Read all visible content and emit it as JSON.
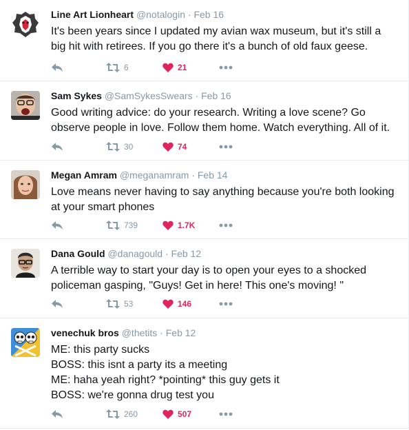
{
  "colors": {
    "like": "#e0245e",
    "meta": "#8899a6",
    "text": "#14171a",
    "divider": "#e6ecf0"
  },
  "icons": {
    "reply": "reply-icon",
    "retweet": "retweet-icon",
    "like": "heart-icon",
    "more": "more-dots-icon"
  },
  "tweets": [
    {
      "name": "Line Art Lionheart",
      "handle": "@notalogin",
      "dot": "·",
      "time": "Feb 16",
      "lines": [
        "It's been years since I updated my avian wax museum, but it's still a",
        "big hit with retirees. If you go there it's a bunch of old faux geese."
      ],
      "retweets": "6",
      "likes": "21"
    },
    {
      "name": "Sam Sykes",
      "handle": "@SamSykesSwears",
      "dot": "·",
      "time": "Feb 16",
      "lines": [
        "Good writing advice: do your research. Writing a love scene? Go",
        "observe people in love. Follow them home. Watch everything. All of it."
      ],
      "retweets": "30",
      "likes": "74"
    },
    {
      "name": "Megan Amram",
      "handle": "@meganamram",
      "dot": "·",
      "time": "Feb 14",
      "lines": [
        "Love means never having to say anything because you're both looking",
        "at your smart phones"
      ],
      "retweets": "739",
      "likes": "1.7K"
    },
    {
      "name": "Dana Gould",
      "handle": "@danagould",
      "dot": "·",
      "time": "Feb 12",
      "lines": [
        "A terrible way to start your day is to open your eyes to a shocked",
        "policeman gasping, \"Guys! Get in here! This one's moving! \""
      ],
      "retweets": "53",
      "likes": "146"
    },
    {
      "name": "venechuk bros",
      "handle": "@thetits",
      "dot": "·",
      "time": "Feb 12",
      "lines": [
        "ME: this party sucks",
        "BOSS: this isnt a party its a meeting",
        "ME: haha yeah right? *pointing* this guy gets it",
        "BOSS: we're gonna drug test you"
      ],
      "retweets": "260",
      "likes": "507"
    }
  ]
}
